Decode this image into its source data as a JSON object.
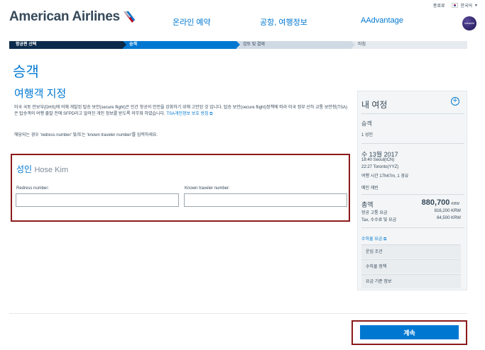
{
  "util": {
    "logout": "종료료",
    "language": "한국어"
  },
  "header": {
    "brand": "American Airlines",
    "nav": [
      "온라인 예약",
      "공항, 여행정보",
      "AAdvantage"
    ],
    "alliance": "oneworld"
  },
  "progress": [
    "항공편 선택",
    "승객",
    "검토 및 결제",
    "마침"
  ],
  "main": {
    "page_title": "승객",
    "section_title": "여행객 지정",
    "paragraph": "미국 국토 안보부(DHS)에 의해 개발된 탑승 보안(secure flight)은 민간 항공의 안전을 강화하기 위해 고안된 것 입니다. 탑승 보안(secure flight)정책에 따라 미국 정부 산하 교통 보안청(TSA)은 탑승객의 여행 출발 전에 SFPD라고 알려진 개인 정보를 받도록 의무화 하였습니다.",
    "paragraph_link": "TSA개인정보 보호 방침",
    "instruction": "해당되는 경우 'redress number' 및/또는 'known traveler number'를 입력하세요.",
    "passenger": {
      "type": "성인",
      "name": "Hose Kim",
      "redress_label": "Redress number:",
      "redress_value": "",
      "ktn_label": "Known traveler number:",
      "ktn_value": ""
    }
  },
  "trip": {
    "title": "내 여정",
    "passengers_label": "승객",
    "passengers_value": "1 성인",
    "date": "수 13월 2017",
    "depart": "18:40 Seoul(ICN)",
    "arrive": "22:27 Toronto(YYZ)",
    "duration": "여행 시간 17h47m, 1 경유",
    "cabin": "메인 캐빈",
    "total_label": "총액",
    "total_value": "880,700",
    "currency": "KRW",
    "fare_label": "항공 고통 요금",
    "fare_value": "816,200 KRW",
    "tax_label": "Tax, 수수료 및 요금",
    "tax_value": "64,500 KRW",
    "baggage_link": "수하물 요금",
    "menu": [
      "운임 조건",
      "수하물 정책",
      "요금 기준 정보"
    ]
  },
  "footer": {
    "continue": "계속"
  },
  "colors": {
    "accent": "#0078d2",
    "navy": "#0b2b4d",
    "highlight": "#8b1a1a"
  }
}
